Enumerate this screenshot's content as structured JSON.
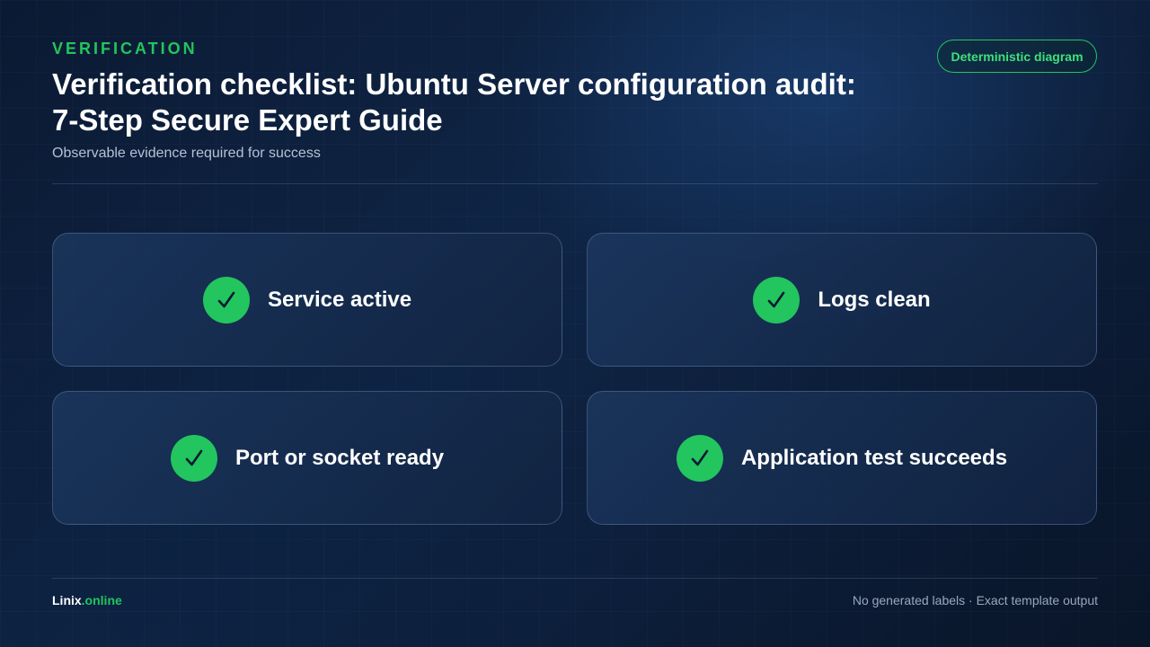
{
  "header": {
    "eyebrow": "VERIFICATION",
    "title_line1": "Verification checklist: Ubuntu Server configuration audit:",
    "title_line2": "7-Step Secure Expert Guide",
    "subtitle": "Observable evidence required for success",
    "badge": "Deterministic diagram"
  },
  "cards": [
    {
      "label": "Service active",
      "icon": "check-icon"
    },
    {
      "label": "Logs clean",
      "icon": "check-icon"
    },
    {
      "label": "Port or socket ready",
      "icon": "check-icon"
    },
    {
      "label": "Application test succeeds",
      "icon": "check-icon"
    }
  ],
  "footer": {
    "brand_part1": "Linix",
    "brand_part2": ".online",
    "note": "No generated labels · Exact template output"
  },
  "colors": {
    "accent": "#22c55e",
    "background": "#0f2546",
    "card_border": "#82a0c8"
  }
}
